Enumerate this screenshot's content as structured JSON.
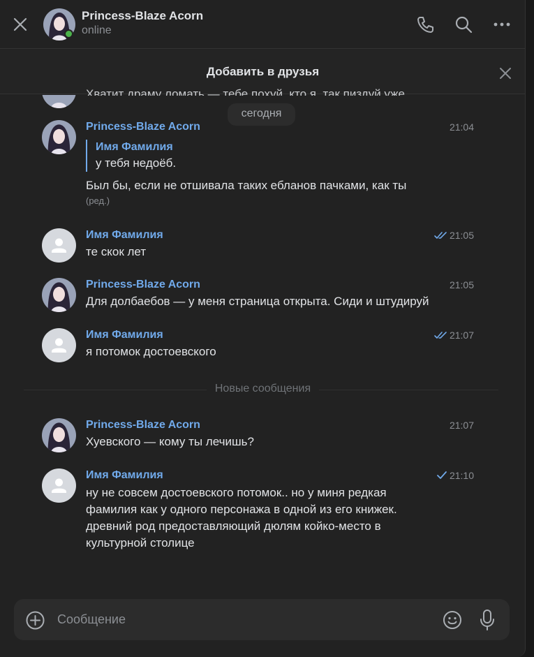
{
  "header": {
    "name": "Princess-Blaze Acorn",
    "status": "online"
  },
  "friend_bar": {
    "label": "Добавить в друзья"
  },
  "date_separator": "сегодня",
  "cut_message": "Хватит драму ломать — тебе похуй, кто я, так пиздуй уже",
  "messages": [
    {
      "author": "Princess-Blaze Acorn",
      "time": "21:04",
      "reply": {
        "name": "Имя Фамилия",
        "text": "у тебя недоёб."
      },
      "text": "Был бы, если не отшивала таких ебланов пачками, как ты",
      "edited": "(ред.)"
    },
    {
      "author": "Имя Фамилия",
      "time": "21:05",
      "read": "double",
      "text": "те скок лет"
    },
    {
      "author": "Princess-Blaze Acorn",
      "time": "21:05",
      "text": "Для долбаебов — у меня страница открыта. Сиди и штудируй"
    },
    {
      "author": "Имя Фамилия",
      "time": "21:07",
      "read": "double",
      "text": "я потомок достоевского"
    },
    {
      "author": "Princess-Blaze Acorn",
      "time": "21:07",
      "text": "Хуевского — кому ты лечишь?"
    },
    {
      "author": "Имя Фамилия",
      "time": "21:10",
      "read": "single",
      "lines": [
        "ну не совсем достоевского потомок.. но у миня редкая",
        "фамилия как у одного персонажа в одной из его книжек.",
        "древний род предоставляющий дюлям койко-место в",
        "культурной столице"
      ]
    }
  ],
  "new_messages_label": "Новые сообщения",
  "composer": {
    "placeholder": "Сообщение"
  },
  "colors": {
    "accent": "#71aaeb",
    "background": "#222222",
    "online": "#4bb34b"
  }
}
